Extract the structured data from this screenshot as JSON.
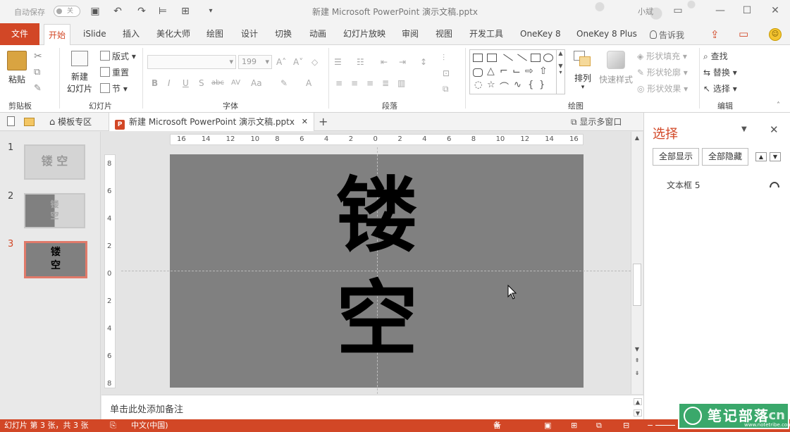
{
  "title_bar": {
    "autosave_label": "自动保存",
    "autosave_state": "关",
    "doc_title": "新建 Microsoft PowerPoint 演示文稿.pptx",
    "user": "小斌"
  },
  "tabs": {
    "file": "文件",
    "items": [
      "开始",
      "iSlide",
      "插入",
      "美化大师",
      "绘图",
      "设计",
      "切换",
      "动画",
      "幻灯片放映",
      "审阅",
      "视图",
      "开发工具",
      "OneKey 8",
      "OneKey 8 Plus"
    ],
    "active_index": 0,
    "tell_me": "告诉我"
  },
  "ribbon": {
    "clipboard": {
      "paste": "粘贴",
      "label": "剪贴板"
    },
    "slides": {
      "new_slide_1": "新建",
      "new_slide_2": "幻灯片",
      "layout": "版式",
      "reset": "重置",
      "section": "节",
      "label": "幻灯片"
    },
    "font": {
      "size": "199",
      "label": "字体",
      "bold": "B",
      "italic": "I",
      "underline": "U",
      "shadow": "S",
      "strike": "abc",
      "spacing": "AV",
      "case": "Aa"
    },
    "paragraph": {
      "label": "段落"
    },
    "drawing": {
      "arrange": "排列",
      "quick_styles": "快速样式",
      "shape_fill": "形状填充",
      "shape_outline": "形状轮廓",
      "shape_effects": "形状效果",
      "label": "绘图"
    },
    "editing": {
      "find": "查找",
      "replace": "替换",
      "select": "选择",
      "label": "编辑"
    }
  },
  "doc_tabs": {
    "template": "模板专区",
    "file": "新建 Microsoft PowerPoint 演示文稿.pptx",
    "multi_window": "显示多窗口"
  },
  "thumbnails": [
    {
      "num": "1",
      "line1": "镂 空",
      "line2": ""
    },
    {
      "num": "2",
      "line1": "镂",
      "line2": "空"
    },
    {
      "num": "3",
      "line1": "镂",
      "line2": "空"
    }
  ],
  "slide": {
    "char1": "镂",
    "char2": "空"
  },
  "ruler": {
    "h": [
      "16",
      "14",
      "12",
      "10",
      "8",
      "6",
      "4",
      "2",
      "0",
      "2",
      "4",
      "6",
      "8",
      "10",
      "12",
      "14",
      "16"
    ],
    "v": [
      "8",
      "6",
      "4",
      "2",
      "0",
      "2",
      "4",
      "6",
      "8"
    ]
  },
  "notes": {
    "placeholder": "单击此处添加备注"
  },
  "selection_pane": {
    "title": "选择",
    "show_all": "全部显示",
    "hide_all": "全部隐藏",
    "items": [
      "文本框 5"
    ]
  },
  "status": {
    "slide_info": "幻灯片 第 3 张，共 3 张",
    "language": "中文(中国)",
    "notes": "备注"
  },
  "watermark": {
    "text": "笔记部落",
    "suffix": "cn",
    "url": "www.notetribe.com"
  },
  "colors": {
    "accent": "#d24726",
    "slide_bg": "#808080",
    "watermark": "#3aa86b"
  }
}
